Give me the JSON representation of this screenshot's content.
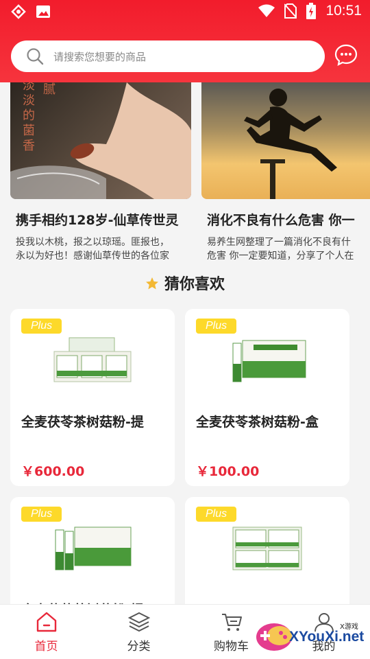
{
  "status_bar": {
    "time": "10:51"
  },
  "search": {
    "placeholder": "请搜索您想要的商品"
  },
  "articles": [
    {
      "title": "携手相约128岁-仙草传世灵",
      "desc_line1": "投我以木桃，报之以琼瑶。匪报也，",
      "desc_line2": "永以为好也！感谢仙草传世的各位家",
      "image_text1": "淡淡的菌香",
      "image_text2": "腻"
    },
    {
      "title": "消化不良有什么危害 你一",
      "desc_line1": "易养生网整理了一篇消化不良有什",
      "desc_line2": "危害 你一定要知道，分享了个人在"
    }
  ],
  "section": {
    "title": "猜你喜欢"
  },
  "products": [
    {
      "badge": "Plus",
      "name": "全麦茯苓茶树菇粉-提",
      "price": "￥600.00"
    },
    {
      "badge": "Plus",
      "name": "全麦茯苓茶树菇粉-盒",
      "price": "￥100.00"
    },
    {
      "badge": "Plus",
      "name": "全麦茯苓茶树菇粉-提",
      "price": ""
    },
    {
      "badge": "Plus",
      "name": "",
      "price": ""
    }
  ],
  "nav": [
    {
      "label": "首页",
      "icon": "home-icon",
      "active": true
    },
    {
      "label": "分类",
      "icon": "layers-icon",
      "active": false
    },
    {
      "label": "购物车",
      "icon": "cart-icon",
      "active": false
    },
    {
      "label": "我的",
      "icon": "user-icon",
      "active": false
    }
  ],
  "watermark": {
    "text": "XYouXi.net",
    "small": "X游戏"
  },
  "colors": {
    "brand_red": "#f21c2c",
    "price_red": "#e8283a",
    "plus_yellow": "#fdd92a"
  }
}
